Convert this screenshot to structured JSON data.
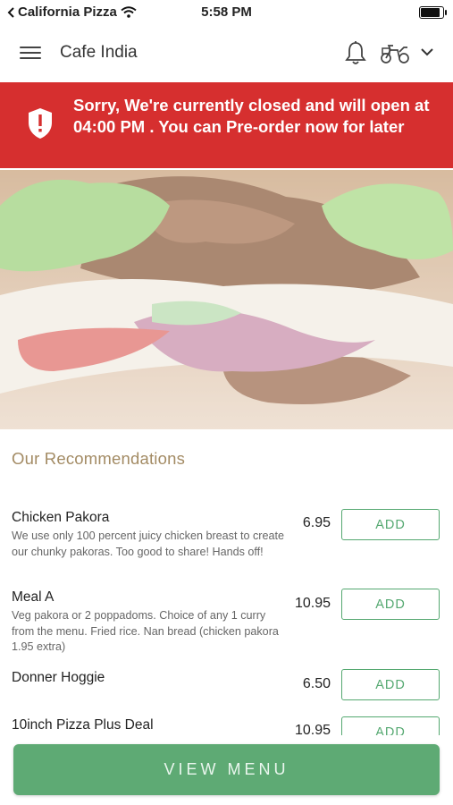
{
  "status_bar": {
    "carrier": "California Pizza",
    "time": "5:58 PM"
  },
  "header": {
    "title": "Cafe India"
  },
  "banner": {
    "message": "Sorry, We're currently closed and will open at 04:00 PM . You can Pre-order now for later"
  },
  "section": {
    "title": "Our Recommendations"
  },
  "items": [
    {
      "name": "Chicken Pakora",
      "description": "We use only 100 percent juicy chicken breast to create our chunky pakoras. Too good to share! Hands off!",
      "price": "6.95",
      "button": "ADD"
    },
    {
      "name": "Meal A",
      "description": "Veg pakora or 2 poppadoms. Choice of any 1 curry from the menu. Fried rice. Nan bread (chicken pakora 1.95 extra)",
      "price": "10.95",
      "button": "ADD"
    },
    {
      "name": "Donner Hoggie",
      "description": "",
      "price": "6.50",
      "button": "ADD"
    },
    {
      "name": "10inch Pizza Plus Deal",
      "description": "",
      "price": "10.95",
      "button": "ADD"
    }
  ],
  "footer": {
    "view_menu_label": "VIEW MENU"
  },
  "colors": {
    "banner_red": "#d62f2f",
    "accent_green": "#5eaa74",
    "section_gold": "#a38b64"
  },
  "icons": [
    "back-arrow-icon",
    "wifi-icon",
    "battery-icon",
    "hamburger-menu-icon",
    "bell-icon",
    "delivery-scooter-icon",
    "chevron-down-icon",
    "shield-alert-icon"
  ]
}
